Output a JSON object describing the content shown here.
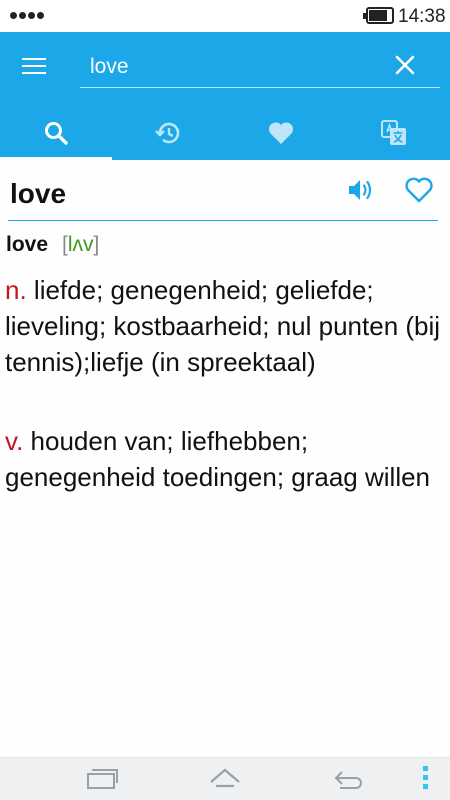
{
  "status_bar": {
    "time": "14:38"
  },
  "search": {
    "query": "love"
  },
  "tabs": [
    {
      "name": "search",
      "icon": "search-icon",
      "active": true
    },
    {
      "name": "history",
      "icon": "history-icon",
      "active": false
    },
    {
      "name": "favorites",
      "icon": "heart-icon",
      "active": false
    },
    {
      "name": "translate",
      "icon": "google-translate-icon",
      "active": false
    }
  ],
  "word": {
    "headword": "love",
    "entry_word": "love",
    "phonetic_open": "[",
    "phonetic": "lʌv",
    "phonetic_close": "]",
    "senses": [
      {
        "pos": "n.",
        "text": "liefde; genegenheid; geliefde; lieveling; kostbaarheid; nul punten (bij tennis);liefje (in spreektaal)"
      },
      {
        "pos": "v.",
        "text": "houden van; liefhebben; genegenheid toedingen; graag willen"
      }
    ]
  },
  "colors": {
    "accent": "#1ca8e8",
    "pos_red": "#c4161c",
    "phonetic_green": "#3a9a1c",
    "navbar_bg": "#eef0f2"
  }
}
